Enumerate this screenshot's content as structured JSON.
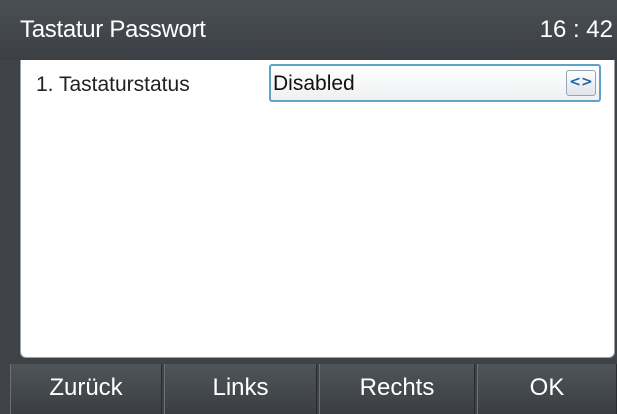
{
  "header": {
    "title": "Tastatur Passwort",
    "time": "16 : 42"
  },
  "settings": {
    "rows": [
      {
        "label": "1. Tastaturstatus",
        "value": "Disabled",
        "switch_glyph": "<>",
        "switch_icon": "left-right-arrows-icon"
      }
    ]
  },
  "softkeys": {
    "back": "Zurück",
    "left": "Links",
    "right": "Rechts",
    "ok": "OK"
  },
  "colors": {
    "background": "#3f4347",
    "panel": "#ffffff",
    "focus_border": "#5fa3c9",
    "arrow": "#1b63a8"
  }
}
